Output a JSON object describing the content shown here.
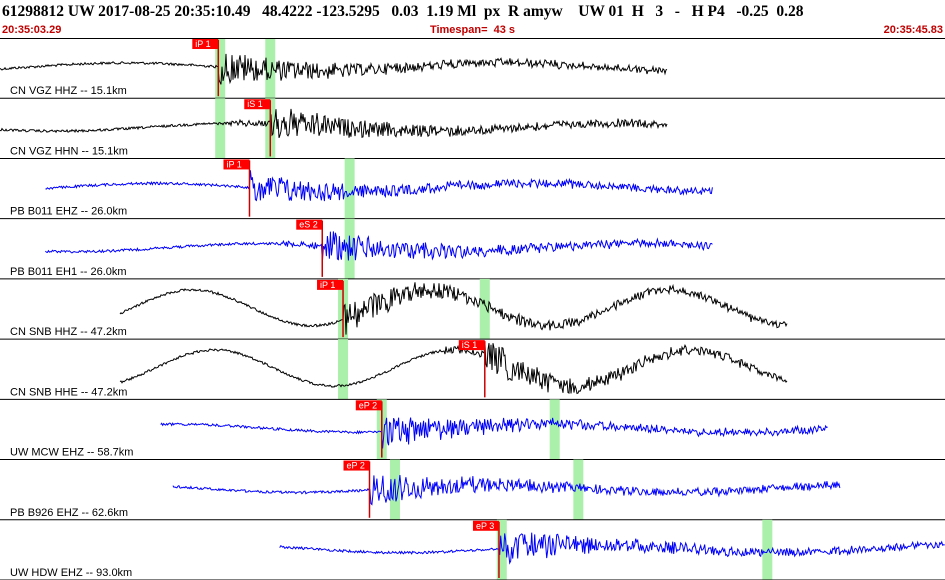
{
  "header": {
    "title": "61298812 UW 2017-08-25 20:35:10.49   48.4222 -123.5295   0.03  1.19 Ml  px  R amyw    UW 01  H   3   -   H P4   -0.25  0.28",
    "start_time": "20:35:03.29",
    "timespan": "Timespan=  43 s",
    "end_time": "20:35:45.83"
  },
  "colors": {
    "trace_black": "#000000",
    "trace_blue": "#0000ff",
    "pick_flag": "#ff0000",
    "pick_line": "#cc0000",
    "highlight": "#aaf0aa",
    "separator": "#000000",
    "subtitle": "#c00000"
  },
  "channels": [
    {
      "label": "CN VGZ HHZ -- 15.1km",
      "color": "black",
      "start": 0,
      "end": 0.706,
      "picks": [
        {
          "text": "iP 1",
          "t": 0.231,
          "wave": "P"
        }
      ],
      "highlights": [
        0.233,
        0.286
      ]
    },
    {
      "label": "CN VGZ HHN -- 15.1km",
      "color": "black",
      "start": 0,
      "end": 0.706,
      "picks": [
        {
          "text": "iS 1",
          "t": 0.286,
          "wave": "S"
        }
      ],
      "highlights": [
        0.233,
        0.286
      ]
    },
    {
      "label": "PB B011 EHZ -- 26.0km",
      "color": "blue",
      "start": 0.048,
      "end": 0.754,
      "picks": [
        {
          "text": "iP 1",
          "t": 0.264,
          "wave": "P"
        }
      ],
      "highlights": [
        0.37
      ]
    },
    {
      "label": "PB B011 EH1 -- 26.0km",
      "color": "blue",
      "start": 0.048,
      "end": 0.754,
      "picks": [
        {
          "text": "eS 2",
          "t": 0.341,
          "wave": "S"
        }
      ],
      "highlights": [
        0.37
      ]
    },
    {
      "label": "CN SNB HHZ -- 47.2km",
      "color": "black",
      "start": 0.127,
      "end": 0.833,
      "picks": [
        {
          "text": "iP 1",
          "t": 0.363,
          "wave": "P"
        }
      ],
      "highlights": [
        0.363,
        0.513
      ]
    },
    {
      "label": "CN SNB HHE -- 47.2km",
      "color": "black",
      "start": 0.127,
      "end": 0.833,
      "picks": [
        {
          "text": "iS 1",
          "t": 0.513,
          "wave": "S"
        }
      ],
      "highlights": [
        0.363
      ]
    },
    {
      "label": "UW MCW EHZ -- 58.7km",
      "color": "blue",
      "start": 0.17,
      "end": 0.876,
      "picks": [
        {
          "text": "eP 2",
          "t": 0.404,
          "wave": "P"
        }
      ],
      "highlights": [
        0.404,
        0.587
      ]
    },
    {
      "label": "PB B926 EHZ -- 62.6km",
      "color": "blue",
      "start": 0.183,
      "end": 0.889,
      "picks": [
        {
          "text": "eP 2",
          "t": 0.391,
          "wave": "P"
        }
      ],
      "highlights": [
        0.418,
        0.612
      ]
    },
    {
      "label": "UW HDW EHZ -- 93.0km",
      "color": "blue",
      "start": 0.296,
      "end": 1.0,
      "picks": [
        {
          "text": "eP 3",
          "t": 0.528,
          "wave": "P"
        }
      ],
      "highlights": [
        0.531,
        0.812
      ]
    }
  ]
}
